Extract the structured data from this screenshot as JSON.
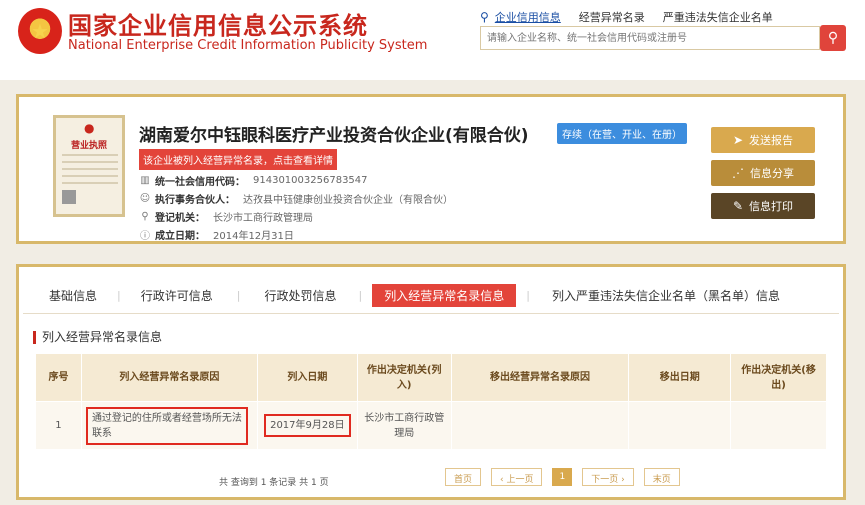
{
  "header": {
    "title": "国家企业信用信息公示系统",
    "subtitle": "National Enterprise Credit Information Publicity System",
    "links": [
      "企业信用信息",
      "经营异常名录",
      "严重违法失信企业名单"
    ],
    "search_placeholder": "请输入企业名称、统一社会信用代码或注册号"
  },
  "company": {
    "license_label": "营业执照",
    "name": "湖南爱尔中钰眼科医疗产业投资合伙企业(有限合伙)",
    "status": "存续（在营、开业、在册）",
    "abnormal_notice": "该企业被列入经营异常名录，点击查看详情",
    "fields": [
      {
        "label": "统一社会信用代码：",
        "value": "914301003256783547"
      },
      {
        "label": "执行事务合伙人：",
        "value": "达孜县中钰健康创业投资合伙企业（有限合伙）"
      },
      {
        "label": "登记机关：",
        "value": "长沙市工商行政管理局"
      },
      {
        "label": "成立日期：",
        "value": "2014年12月31日"
      }
    ],
    "actions": [
      "发送报告",
      "信息分享",
      "信息打印"
    ]
  },
  "tabs": [
    "基础信息",
    "行政许可信息",
    "行政处罚信息",
    "列入经营异常名录信息",
    "列入严重违法失信企业名单（黑名单）信息"
  ],
  "section_title": "列入经营异常名录信息",
  "table": {
    "headers": [
      "序号",
      "列入经营异常名录原因",
      "列入日期",
      "作出决定机关(列入)",
      "移出经营异常名录原因",
      "移出日期",
      "作出决定机关(移出)"
    ],
    "rows": [
      [
        "1",
        "通过登记的住所或者经营场所无法联系",
        "2017年9月28日",
        "长沙市工商行政管理局",
        "",
        "",
        ""
      ]
    ]
  },
  "pager": {
    "summary": "共 查询到 1 条记录 共 1 页",
    "first": "首页",
    "prev": "‹ 上一页",
    "current": "1",
    "next": "下一页 ›",
    "last": "末页"
  },
  "colors": {
    "brand_red": "#c8271d",
    "gold_border": "#d8b86a",
    "badge_blue": "#3c8dde"
  }
}
